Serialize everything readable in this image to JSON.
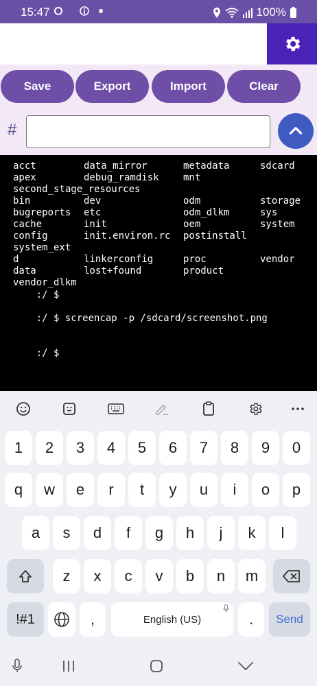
{
  "status": {
    "time": "15:47",
    "battery": "100%"
  },
  "toolbar": {
    "save": "Save",
    "export": "Export",
    "import": "Import",
    "clear": "Clear"
  },
  "command": {
    "prompt": "#",
    "value": ""
  },
  "terminal": {
    "rows": [
      [
        "acct",
        "data_mirror",
        "metadata",
        "sdcard"
      ],
      [
        "apex",
        "debug_ramdisk",
        "mnt",
        ""
      ],
      [
        "second_stage_resources",
        "",
        "",
        ""
      ],
      [
        "bin",
        "dev",
        "odm",
        "storage"
      ],
      [
        "bugreports",
        "etc",
        "odm_dlkm",
        "sys"
      ],
      [
        "cache",
        "init",
        "oem",
        "system"
      ],
      [
        "config",
        "init.environ.rc",
        "postinstall",
        ""
      ],
      [
        "system_ext",
        "",
        "",
        ""
      ],
      [
        "d",
        "linkerconfig",
        "proc",
        "vendor"
      ],
      [
        "data",
        "lost+found",
        "product",
        ""
      ],
      [
        "vendor_dlkm",
        "",
        "",
        ""
      ]
    ],
    "prompt1": "    :/ $",
    "prompt2": "    :/ $ screencap -p /sdcard/screenshot.png",
    "prompt3": "    :/ $"
  },
  "keyboard": {
    "row_numbers": [
      "1",
      "2",
      "3",
      "4",
      "5",
      "6",
      "7",
      "8",
      "9",
      "0"
    ],
    "row1": [
      "q",
      "w",
      "e",
      "r",
      "t",
      "y",
      "u",
      "i",
      "o",
      "p"
    ],
    "row2": [
      "a",
      "s",
      "d",
      "f",
      "g",
      "h",
      "j",
      "k",
      "l"
    ],
    "row3": [
      "z",
      "x",
      "c",
      "v",
      "b",
      "n",
      "m"
    ],
    "symbols": "!#1",
    "comma": ",",
    "space": "English (US)",
    "period": ".",
    "send": "Send"
  },
  "icons": [
    "settings-gear-icon",
    "chevron-up-icon",
    "emoji-icon",
    "sticker-icon",
    "keyboard-icon",
    "handwriting-icon",
    "clipboard-icon",
    "keyboard-settings-icon",
    "more-icon",
    "shift-icon",
    "backspace-icon",
    "globe-icon",
    "mic-icon",
    "recents-icon",
    "home-icon",
    "back-icon"
  ],
  "colors": {
    "statusbar": "#6a4fa6",
    "accent": "#4a22b8",
    "button": "#6e4ea6",
    "send": "#3f5ac0"
  }
}
